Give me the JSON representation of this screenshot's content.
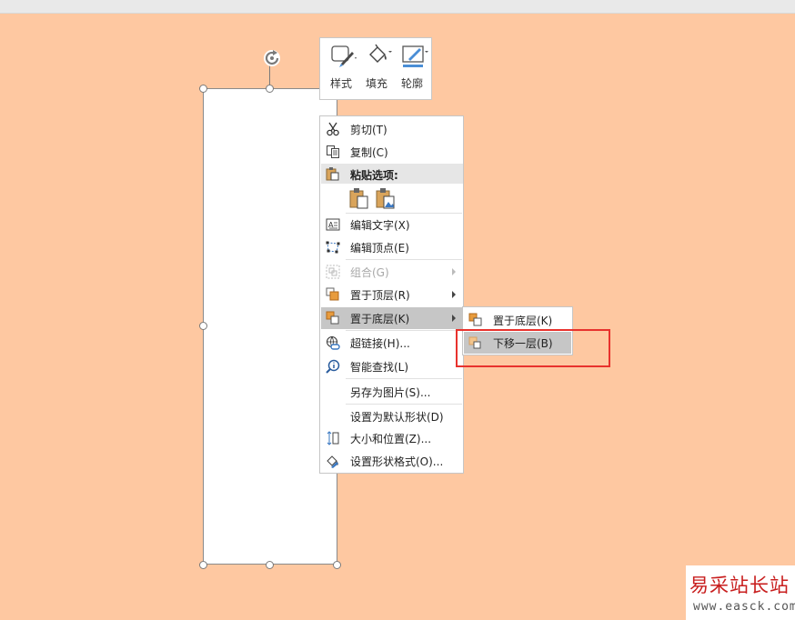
{
  "mini_toolbar": {
    "style_label": "样式",
    "fill_label": "填充",
    "outline_label": "轮廓"
  },
  "context_menu": {
    "cut": "剪切(T)",
    "copy": "复制(C)",
    "paste_options": "粘贴选项:",
    "edit_text": "编辑文字(X)",
    "edit_points": "编辑顶点(E)",
    "group": "组合(G)",
    "bring_to_front": "置于顶层(R)",
    "send_to_back": "置于底层(K)",
    "hyperlink": "超链接(H)...",
    "smart_lookup": "智能查找(L)",
    "save_as_picture": "另存为图片(S)...",
    "set_default_shape": "设置为默认形状(D)",
    "size_position": "大小和位置(Z)...",
    "format_shape": "设置形状格式(O)..."
  },
  "submenu": {
    "send_to_back": "置于底层(K)",
    "send_backward": "下移一层(B)"
  },
  "watermark": {
    "title": "易采站长站",
    "url": "www.easck.com"
  },
  "colors": {
    "canvas_bg": "#fec8a1",
    "highlight": "#c6c6c6",
    "red_box": "#e8322d"
  }
}
